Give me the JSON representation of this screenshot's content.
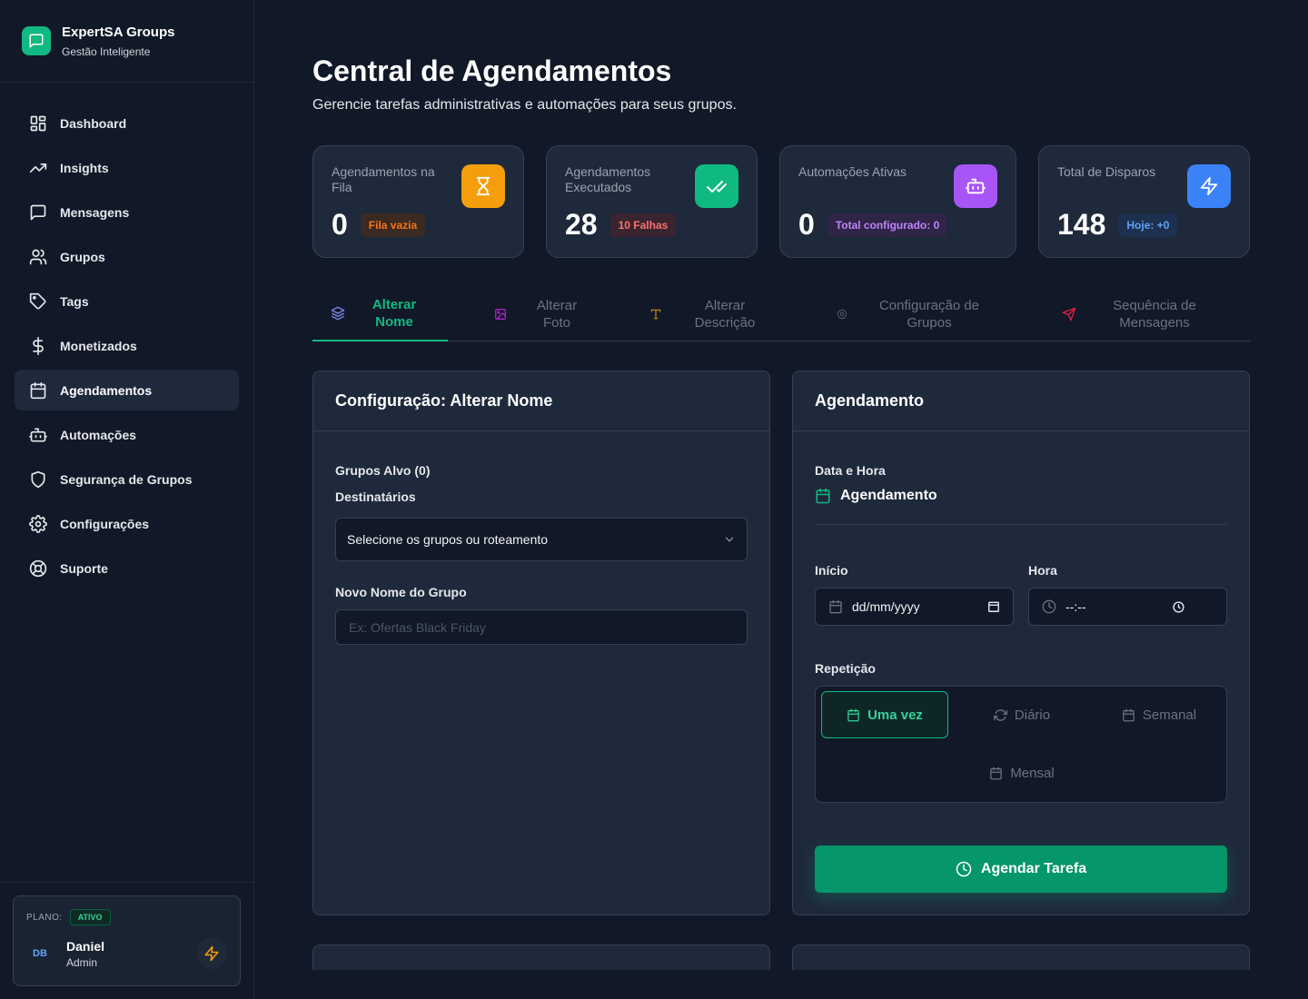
{
  "brand": {
    "title": "ExpertSA Groups",
    "subtitle": "Gestão Inteligente",
    "accent": "#10b981"
  },
  "sidebar": {
    "items": [
      {
        "label": "Dashboard",
        "icon": "dashboard-icon",
        "active": false
      },
      {
        "label": "Insights",
        "icon": "trending-up-icon",
        "active": false
      },
      {
        "label": "Mensagens",
        "icon": "message-icon",
        "active": false
      },
      {
        "label": "Grupos",
        "icon": "users-icon",
        "active": false
      },
      {
        "label": "Tags",
        "icon": "tag-icon",
        "active": false
      },
      {
        "label": "Monetizados",
        "icon": "dollar-icon",
        "active": false
      },
      {
        "label": "Agendamentos",
        "icon": "calendar-icon",
        "active": true
      },
      {
        "label": "Automações",
        "icon": "robot-icon",
        "active": false
      },
      {
        "label": "Segurança de Grupos",
        "icon": "shield-icon",
        "active": false
      },
      {
        "label": "Configurações",
        "icon": "gear-icon",
        "active": false
      },
      {
        "label": "Suporte",
        "icon": "lifebuoy-icon",
        "active": false
      }
    ],
    "plan": {
      "label": "PLANO:",
      "status": "ATIVO"
    },
    "user": {
      "initials": "DB",
      "name": "Daniel",
      "role": "Admin"
    }
  },
  "header": {
    "title": "Central de Agendamentos",
    "subtitle": "Gerencie tarefas administrativas e automações para seus grupos."
  },
  "stats": [
    {
      "label": "Agendamentos na Fila",
      "value": "0",
      "badge": "Fila vazia",
      "icon": "hourglass-icon",
      "icon_bg": "#f59e0b",
      "badge_color": "#f97316",
      "badge_bg": "#3a2a22"
    },
    {
      "label": "Agendamentos Executados",
      "value": "28",
      "badge": "10 Falhas",
      "icon": "double-check-icon",
      "icon_bg": "#10b981",
      "badge_color": "#f87171",
      "badge_bg": "#3a2430"
    },
    {
      "label": "Automações Ativas",
      "value": "0",
      "badge": "Total configurado: 0",
      "icon": "robot-icon",
      "icon_bg": "#a855f7",
      "badge_color": "#c084fc",
      "badge_bg": "#2e2547"
    },
    {
      "label": "Total de Disparos",
      "value": "148",
      "badge": "Hoje: +0",
      "icon": "bolt-icon",
      "icon_bg": "#3b82f6",
      "badge_color": "#60a5fa",
      "badge_bg": "#1e3050"
    }
  ],
  "tabs": [
    {
      "label": "Alterar\nNome",
      "icon": "layers-icon",
      "active": true,
      "icon_color": "#818cf8"
    },
    {
      "label": "Alterar\nFoto",
      "icon": "image-icon",
      "active": false,
      "icon_color": "#c026d3"
    },
    {
      "label": "Alterar\nDescrição",
      "icon": "text-icon",
      "active": false,
      "icon_color": "#ca8a04"
    },
    {
      "label": "Configuração de\nGrupos",
      "icon": "gear-icon",
      "active": false,
      "icon_color": "#4b5563"
    },
    {
      "label": "Sequência de\nMensagens",
      "icon": "send-icon",
      "active": false,
      "icon_color": "#e11d48"
    }
  ],
  "config_panel": {
    "title": "Configuração: Alterar Nome",
    "targets_label": "Grupos Alvo (0)",
    "recipients_label": "Destinatários",
    "recipients_value": "Selecione os grupos ou roteamento",
    "new_name_label": "Novo Nome do Grupo",
    "new_name_placeholder": "Ex: Ofertas Black Friday",
    "new_name_value": ""
  },
  "schedule_panel": {
    "title": "Agendamento",
    "datetime_label": "Data e Hora",
    "section_title": "Agendamento",
    "start_label": "Início",
    "start_value": "dd/mm/yyyy",
    "time_label": "Hora",
    "time_value": "--:--",
    "repeat_label": "Repetição",
    "repeat_options": [
      {
        "label": "Uma vez",
        "icon": "calendar-icon",
        "active": true
      },
      {
        "label": "Diário",
        "icon": "refresh-icon",
        "active": false
      },
      {
        "label": "Semanal",
        "icon": "calendar-icon",
        "active": false
      },
      {
        "label": "Mensal",
        "icon": "calendar-icon",
        "active": false
      }
    ],
    "submit_label": "Agendar Tarefa"
  }
}
